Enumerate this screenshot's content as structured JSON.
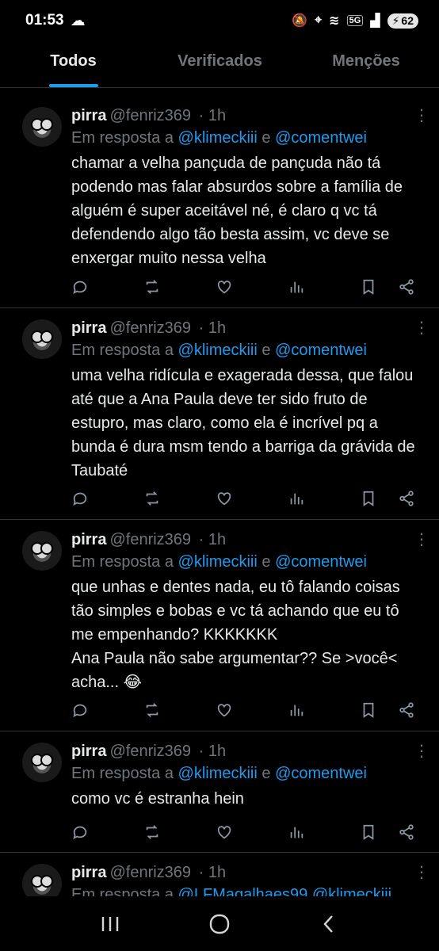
{
  "status_bar": {
    "time": "01:53",
    "network": "5G",
    "battery": "62"
  },
  "tabs": [
    {
      "label": "Todos",
      "active": true
    },
    {
      "label": "Verificados",
      "active": false
    },
    {
      "label": "Menções",
      "active": false
    }
  ],
  "tweets": [
    {
      "name": "pirra",
      "handle": "@fenriz369",
      "time": "· 1h",
      "reply_prefix": "Em resposta a",
      "reply_to_1": "@klimeckiii",
      "reply_joiner": "e",
      "reply_to_2": "@comentwei",
      "text": "chamar a velha pançuda de pançuda não tá podendo mas falar absurdos sobre a família de alguém é super aceitável né, é claro q vc tá defendendo algo tão besta assim, vc deve se enxergar muito nessa velha"
    },
    {
      "name": "pirra",
      "handle": "@fenriz369",
      "time": "· 1h",
      "reply_prefix": "Em resposta a",
      "reply_to_1": "@klimeckiii",
      "reply_joiner": "e",
      "reply_to_2": "@comentwei",
      "text": "uma velha ridícula e exagerada dessa, que falou até que a Ana Paula deve ter sido fruto de estupro, mas claro, como ela é incrível pq a bunda é dura msm tendo a barriga da grávida de Taubaté"
    },
    {
      "name": "pirra",
      "handle": "@fenriz369",
      "time": "· 1h",
      "reply_prefix": "Em resposta a",
      "reply_to_1": "@klimeckiii",
      "reply_joiner": "e",
      "reply_to_2": "@comentwei",
      "text": "que unhas e dentes nada, eu tô falando coisas tão simples e bobas e vc tá achando que eu tô me empenhando? KKKKKKK\nAna Paula não sabe argumentar?? Se >você< acha... 😂"
    },
    {
      "name": "pirra",
      "handle": "@fenriz369",
      "time": "· 1h",
      "reply_prefix": "Em resposta a",
      "reply_to_1": "@klimeckiii",
      "reply_joiner": "e",
      "reply_to_2": "@comentwei",
      "text": "como vc é estranha hein"
    },
    {
      "name": "pirra",
      "handle": "@fenriz369",
      "time": "· 1h",
      "reply_prefix": "Em resposta a",
      "reply_to_1": "@LFMagalhaes99",
      "reply_joiner": "",
      "reply_to_2": "@klimeckiii",
      "text": ""
    }
  ],
  "colors": {
    "accent": "#1d9bf0",
    "background": "#000000",
    "muted": "#71767b",
    "text": "#e7e9ea"
  }
}
